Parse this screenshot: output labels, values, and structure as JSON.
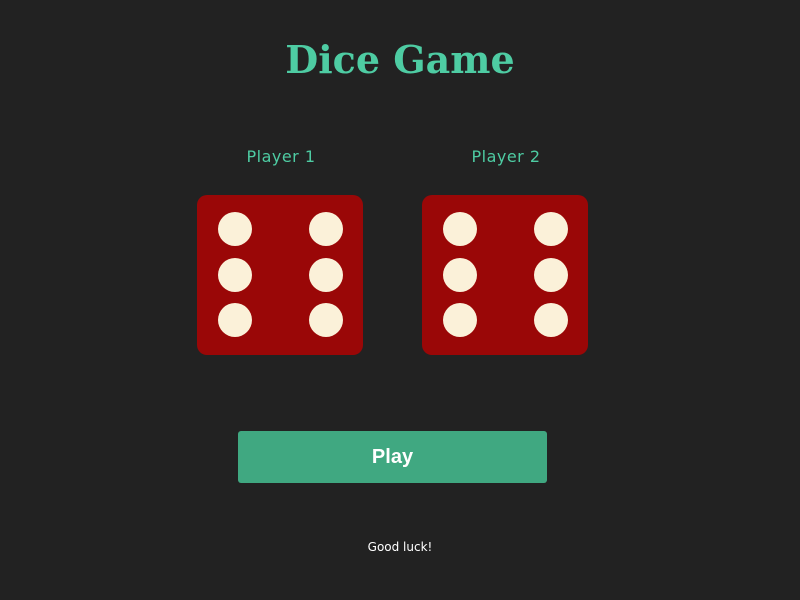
{
  "title": "Dice Game",
  "players": [
    {
      "label": "Player 1",
      "die_value": 6
    },
    {
      "label": "Player 2",
      "die_value": 6
    }
  ],
  "play_button": {
    "label": "Play"
  },
  "footer_text": "Good luck!",
  "colors": {
    "background": "#222222",
    "accent": "#4ecca3",
    "die": "#9a0707",
    "pip": "#fbf1d9",
    "button": "#40a881",
    "footer_text": "#ffffff"
  }
}
